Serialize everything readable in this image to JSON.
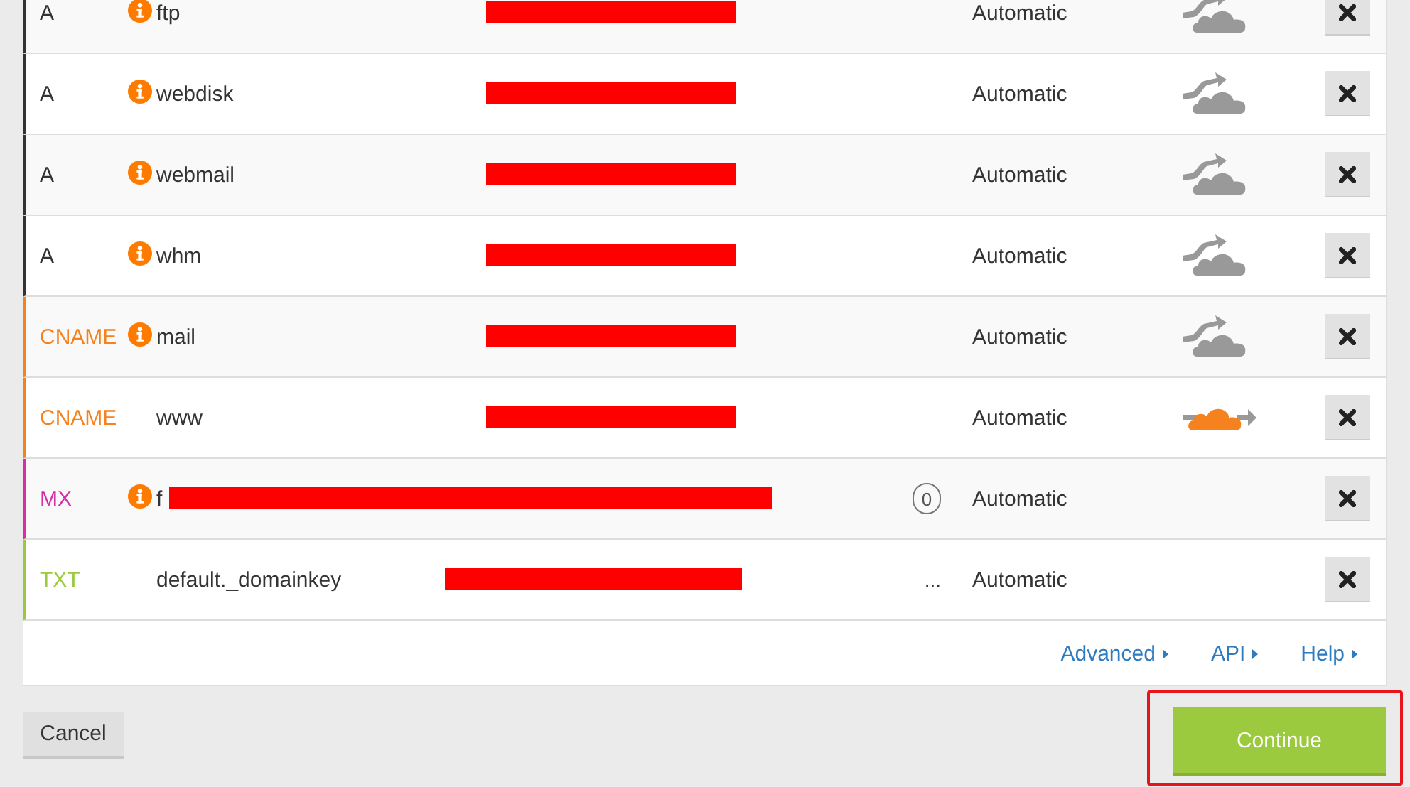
{
  "records": [
    {
      "type": "A",
      "color": "#333333",
      "warning": true,
      "name": "ftp",
      "redacted": true,
      "proxied": false,
      "ttl": "Automatic"
    },
    {
      "type": "A",
      "color": "#333333",
      "warning": true,
      "name": "webdisk",
      "redacted": true,
      "proxied": false,
      "ttl": "Automatic"
    },
    {
      "type": "A",
      "color": "#333333",
      "warning": true,
      "name": "webmail",
      "redacted": true,
      "proxied": false,
      "ttl": "Automatic"
    },
    {
      "type": "A",
      "color": "#333333",
      "warning": true,
      "name": "whm",
      "redacted": true,
      "proxied": false,
      "ttl": "Automatic"
    },
    {
      "type": "CNAME",
      "color": "#f6821f",
      "warning": true,
      "name": "mail",
      "redacted": true,
      "proxied": false,
      "ttl": "Automatic"
    },
    {
      "type": "CNAME",
      "color": "#f6821f",
      "warning": false,
      "name": "www",
      "redacted": true,
      "proxied": true,
      "ttl": "Automatic"
    },
    {
      "type": "MX",
      "color": "#d62fa6",
      "warning": true,
      "name": "f",
      "redacted": true,
      "priority": "0",
      "ttl": "Automatic"
    },
    {
      "type": "TXT",
      "color": "#9bca3e",
      "warning": false,
      "name": "default._domainkey",
      "redacted": true,
      "value_tail": "...",
      "ttl": "Automatic"
    }
  ],
  "links": [
    "Advanced",
    "API",
    "Help"
  ],
  "cancel": {
    "label": "Cancel"
  },
  "continue": {
    "label": "Continue",
    "highlighted": true
  }
}
